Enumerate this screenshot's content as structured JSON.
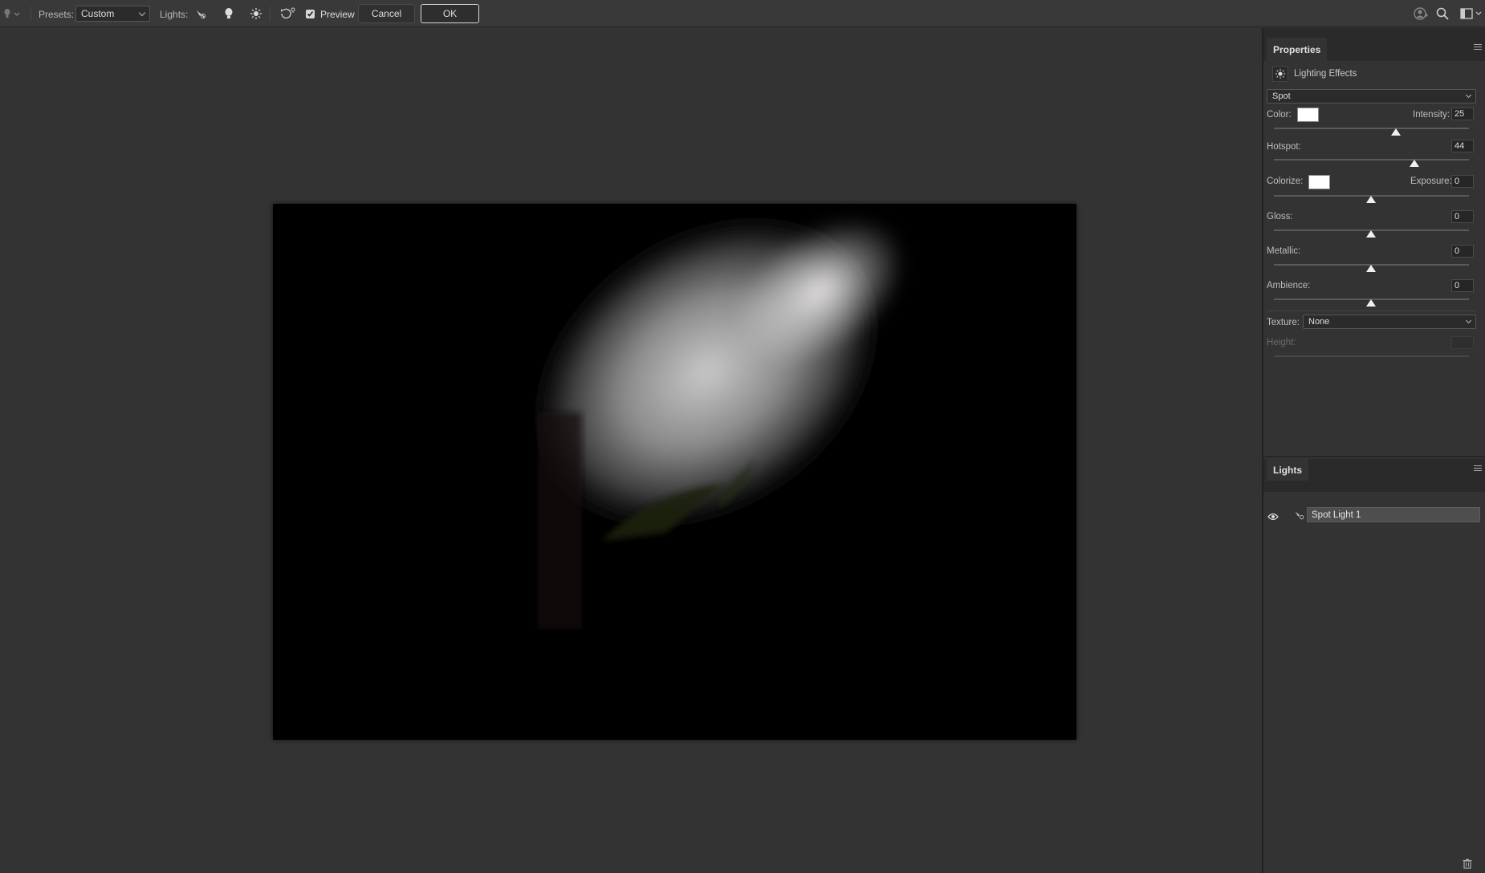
{
  "options_bar": {
    "presets_label": "Presets:",
    "presets_value": "Custom",
    "lights_label": "Lights:",
    "preview_label": "Preview",
    "preview_checked": true,
    "cancel_label": "Cancel",
    "ok_label": "OK"
  },
  "properties": {
    "tab_label": "Properties",
    "filter_name": "Lighting Effects",
    "light_type": "Spot",
    "color_label": "Color:",
    "intensity_label": "Intensity:",
    "intensity_value": "25",
    "hotspot_label": "Hotspot:",
    "hotspot_value": "44",
    "colorize_label": "Colorize:",
    "exposure_label": "Exposure:",
    "exposure_value": "0",
    "gloss_label": "Gloss:",
    "gloss_value": "0",
    "metallic_label": "Metallic:",
    "metallic_value": "0",
    "ambience_label": "Ambience:",
    "ambience_value": "0",
    "texture_label": "Texture:",
    "texture_value": "None",
    "height_label": "Height:"
  },
  "lights_panel": {
    "tab_label": "Lights",
    "items": [
      {
        "label": "Spot Light 1",
        "visible": true
      }
    ]
  }
}
